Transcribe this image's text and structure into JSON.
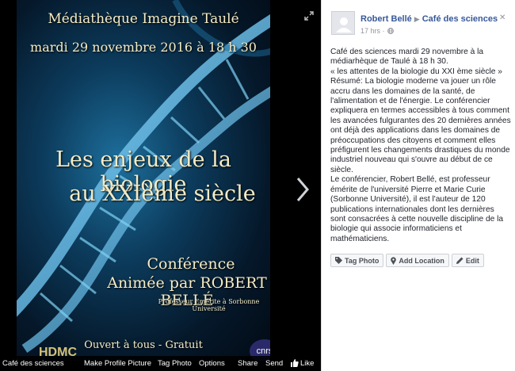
{
  "poster": {
    "venue": "Médiathèque Imagine Taulé",
    "date": "mardi 29 novembre 2016 à 18 h 30",
    "title_line1": "Les enjeux de la biologie",
    "title_line2": "au XXIème siècle",
    "conference": "Conférence",
    "animated_by": "Animée par ROBERT BELLÉ",
    "speaker_title": "Professeur Emérite à Sorbonne Université",
    "open_to_all": "Ouvert à tous - Gratuit",
    "logo_left": "HDMC",
    "logo_right": "cnrs"
  },
  "toolbar": {
    "album": "Café des sciences",
    "make_profile": "Make Profile Picture",
    "tag_photo": "Tag Photo",
    "options": "Options",
    "share": "Share",
    "send": "Send",
    "like": "Like"
  },
  "post": {
    "author": "Robert Bellé",
    "group": "Café des sciences",
    "time": "17 hrs",
    "body": "Café des sciences mardi 29 novembre à la médiarhèque de Taulé à 18 h 30.\n« les attentes de la biologie du XXI ème siècle »\nRésumé: La biologie moderne va jouer un rôle accru dans les domaines de la santé, de l'alimentation et de l'énergie. Le conférencier expliquera en termes accessibles à tous comment les avancées fulgurantes des 20 dernières années ont déjà des applications dans les domaines de préoccupations des citoyens et comment elles préfigurent les changements drastiques du monde industriel nouveau qui s'ouvre au début de ce siècle.\nLe conférencier, Robert Bellé, est professeur émérite de l'université Pierre et Marie Curie (Sorbonne Université), il est l'auteur de 120 publications internationales dont les dernières sont consacrées à cette nouvelle discipline de la biologie qui associe informaticiens et mathématiciens.",
    "actions": {
      "tag_photo": "Tag Photo",
      "add_location": "Add Location",
      "edit": "Edit"
    }
  },
  "icons": {
    "globe": "globe-icon",
    "tag": "tag-icon",
    "location": "location-pin-icon",
    "edit": "pencil-icon",
    "like": "thumbs-up-icon",
    "next": "chevron-right-icon",
    "expand": "expand-icon",
    "close": "close-icon"
  }
}
